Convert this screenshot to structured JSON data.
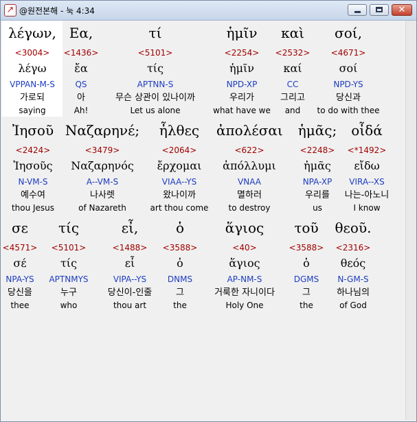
{
  "window": {
    "title": "@원전본해 - 눅 4:34",
    "app_icon_glyph": "↗"
  },
  "colors": {
    "strong_number": "#a00000",
    "parsing_code": "#1c3cc0",
    "selected_background": "#ffffff",
    "panel_background": "#f0f0f0"
  },
  "rows": [
    {
      "tokens": [
        {
          "greek": "λέγων,",
          "strong": "<3004>",
          "lemma": "λέγω",
          "parse": "VPPAN-M-S",
          "korean": "가로되",
          "english": "saying",
          "selected": true
        },
        {
          "greek": "Εα,",
          "strong": "<1436>",
          "lemma": "ἔα",
          "parse": "QS",
          "korean": "아",
          "english": "Ah!"
        },
        {
          "greek": "τί",
          "strong": "<5101>",
          "lemma": "τίς",
          "parse": "APTNN-S",
          "korean": "무슨 상관이 있나이까",
          "english": "Let us alone"
        },
        {
          "greek": "ἡμῖν",
          "strong": "<2254>",
          "lemma": "ἡμῖν",
          "parse": "NPD-XP",
          "korean": "우리가",
          "english": "what have we"
        },
        {
          "greek": "καὶ",
          "strong": "<2532>",
          "lemma": "καί",
          "parse": "CC",
          "korean": "그리고",
          "english": "and"
        },
        {
          "greek": "σοί,",
          "strong": "<4671>",
          "lemma": "σοί",
          "parse": "NPD-YS",
          "korean": "당신과",
          "english": "to do with thee"
        }
      ]
    },
    {
      "tokens": [
        {
          "greek": "Ἰησοῦ",
          "strong": "<2424>",
          "lemma": "Ἰησοῦς",
          "parse": "N-VM-S",
          "korean": "예수여",
          "english": "thou Jesus"
        },
        {
          "greek": "Ναζαρηνέ;",
          "strong": "<3479>",
          "lemma": "Ναζαρηνός",
          "parse": "A--VM-S",
          "korean": "나사렛",
          "english": "of Nazareth"
        },
        {
          "greek": "ἦλθες",
          "strong": "<2064>",
          "lemma": "ἔρχομαι",
          "parse": "VIAA--YS",
          "korean": "왔나이까",
          "english": "art thou come"
        },
        {
          "greek": "ἀπολέσαι",
          "strong": "<622>",
          "lemma": "ἀπόλλυμι",
          "parse": "VNAA",
          "korean": "멸하러",
          "english": "to destroy"
        },
        {
          "greek": "ἡμᾶς;",
          "strong": "<2248>",
          "lemma": "ἡμᾶς",
          "parse": "NPA-XP",
          "korean": "우리를",
          "english": "us"
        },
        {
          "greek": "οἶδά",
          "strong": "<*1492>",
          "lemma": "εἴδω",
          "parse": "VIRA--XS",
          "korean": "나는-아노니",
          "english": "I know"
        }
      ]
    },
    {
      "tokens": [
        {
          "greek": "σε",
          "strong": "<4571>",
          "lemma": "σέ",
          "parse": "NPA-YS",
          "korean": "당신을",
          "english": "thee"
        },
        {
          "greek": "τίς",
          "strong": "<5101>",
          "lemma": "τίς",
          "parse": "APTNMYS",
          "korean": "누구",
          "english": "who"
        },
        {
          "greek": "εἶ,",
          "strong": "<1488>",
          "lemma": "εἶ",
          "parse": "VIPA--YS",
          "korean": "당신이-인줄",
          "english": "thou art"
        },
        {
          "greek": "ὁ",
          "strong": "<3588>",
          "lemma": "ὁ",
          "parse": "DNMS",
          "korean": "그",
          "english": "the"
        },
        {
          "greek": "ἅγιος",
          "strong": "<40>",
          "lemma": "ἅγιος",
          "parse": "AP-NM-S",
          "korean": "거룩한 자니이다",
          "english": "Holy One"
        },
        {
          "greek": "τοῦ",
          "strong": "<3588>",
          "lemma": "ὁ",
          "parse": "DGMS",
          "korean": "그",
          "english": "the"
        },
        {
          "greek": "θεοῦ.",
          "strong": "<2316>",
          "lemma": "θεός",
          "parse": "N-GM-S",
          "korean": "하나님의",
          "english": "of God"
        }
      ]
    }
  ]
}
